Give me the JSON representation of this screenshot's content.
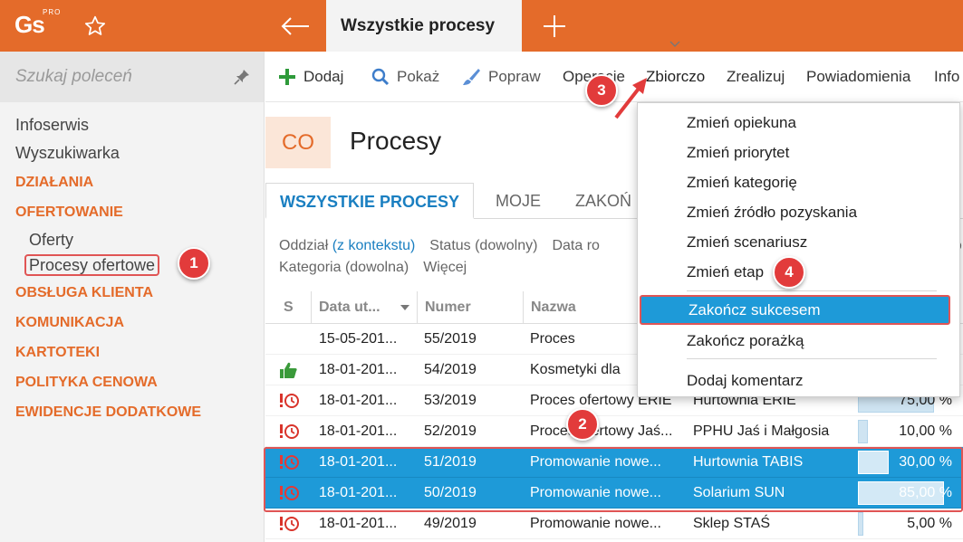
{
  "app": {
    "logo_text": "Gs",
    "logo_badge": "PRO"
  },
  "header": {
    "active_tab": "Wszystkie procesy"
  },
  "sidebar": {
    "search_placeholder": "Szukaj poleceń",
    "items": [
      {
        "label": "Infoserwis"
      },
      {
        "label": "Wyszukiwarka"
      }
    ],
    "sections": [
      {
        "label": "DZIAŁANIA"
      },
      {
        "label": "OFERTOWANIE"
      },
      {
        "label": "OBSŁUGA KLIENTA"
      },
      {
        "label": "KOMUNIKACJA"
      },
      {
        "label": "KARTOTEKI"
      },
      {
        "label": "POLITYKA CENOWA"
      },
      {
        "label": "EWIDENCJE DODATKOWE"
      }
    ],
    "ofertowanie_children": [
      {
        "label": "Oferty"
      },
      {
        "label": "Procesy ofertowe"
      }
    ]
  },
  "toolbar": {
    "add": "Dodaj",
    "show": "Pokaż",
    "edit": "Popraw",
    "operations": "Operacje",
    "bulk": "Zbiorczo",
    "realize": "Zrealizuj",
    "notifications": "Powiadomienia",
    "info": "Info"
  },
  "page": {
    "badge": "CO",
    "title": "Procesy"
  },
  "tabs": [
    {
      "label": "WSZYSTKIE PROCESY"
    },
    {
      "label": "MOJE"
    },
    {
      "label": "ZAKOŃ"
    }
  ],
  "filters": {
    "row1": {
      "branch_label": "Oddział",
      "branch_value": "(z kontekstu)",
      "status": "Status (dowolny)",
      "date": "Data ro",
      "tail": "do"
    },
    "row2": {
      "category": "Kategoria (dowolna)",
      "more": "Więcej"
    }
  },
  "table": {
    "columns": {
      "status": "S",
      "date": "Data ut...",
      "number": "Numer",
      "name": "Nazwa"
    },
    "rows": [
      {
        "status": "",
        "date": "15-05-201...",
        "number": "55/2019",
        "name": "Proces",
        "client": "",
        "pct": "%",
        "pct_value": 0
      },
      {
        "status": "thumbs-up",
        "date": "18-01-201...",
        "number": "54/2019",
        "name": "Kosmetyki dla",
        "client": "",
        "pct": "%",
        "pct_value": 0
      },
      {
        "status": "overdue",
        "date": "18-01-201...",
        "number": "53/2019",
        "name": "Proces ofertowy ERIE",
        "client": "Hurtownia ERIE",
        "pct": "75,00 %",
        "pct_value": 0.75
      },
      {
        "status": "overdue",
        "date": "18-01-201...",
        "number": "52/2019",
        "name": "Proces ofertowy Jaś...",
        "client": "PPHU Jaś i Małgosia",
        "pct": "10,00 %",
        "pct_value": 0.1
      },
      {
        "status": "overdue",
        "date": "18-01-201...",
        "number": "51/2019",
        "name": "Promowanie nowe...",
        "client": "Hurtownia TABIS",
        "pct": "30,00 %",
        "pct_value": 0.3
      },
      {
        "status": "overdue",
        "date": "18-01-201...",
        "number": "50/2019",
        "name": "Promowanie nowe...",
        "client": "Solarium SUN",
        "pct": "85,00 %",
        "pct_value": 0.85
      },
      {
        "status": "overdue",
        "date": "18-01-201...",
        "number": "49/2019",
        "name": "Promowanie nowe...",
        "client": "Sklep STAŚ",
        "pct": "5,00 %",
        "pct_value": 0.05
      }
    ]
  },
  "dropdown": {
    "items": [
      {
        "label": "Zmień opiekuna"
      },
      {
        "label": "Zmień priorytet"
      },
      {
        "label": "Zmień kategorię"
      },
      {
        "label": "Zmień źródło pozyskania"
      },
      {
        "label": "Zmień scenariusz"
      },
      {
        "label": "Zmień etap"
      },
      {
        "label": "Zakończ sukcesem"
      },
      {
        "label": "Zakończ porażką"
      },
      {
        "label": "Dodaj komentarz"
      }
    ]
  },
  "callouts": {
    "c1": "1",
    "c2": "2",
    "c3": "3",
    "c4": "4"
  },
  "colors": {
    "accent": "#e46b2a",
    "selection": "#1e9ad8",
    "callout": "#e23b3b",
    "link": "#1a7fc1"
  }
}
